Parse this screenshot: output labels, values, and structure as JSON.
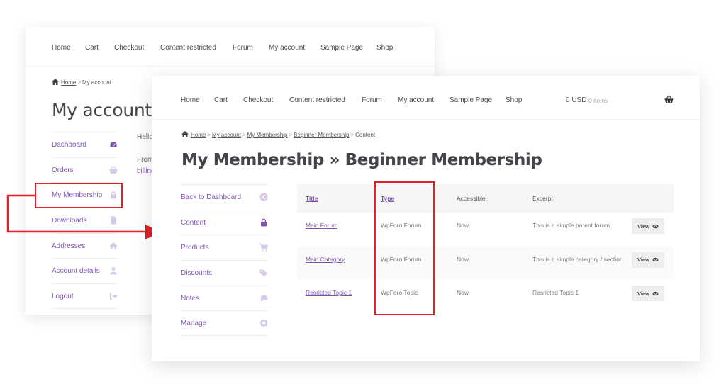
{
  "nav_items": [
    "Home",
    "Cart",
    "Checkout",
    "Content restricted",
    "Forum",
    "My account",
    "Sample Page",
    "Shop"
  ],
  "back_panel": {
    "breadcrumb": {
      "home": "Home",
      "current": "My account",
      "separator": ">"
    },
    "title": "My account",
    "menu": [
      {
        "label": "Dashboard",
        "icon": "dashboard-icon",
        "active": true
      },
      {
        "label": "Orders",
        "icon": "basket-icon",
        "active": false
      },
      {
        "label": "My Membership",
        "icon": "lock-icon",
        "active": false,
        "highlighted": true
      },
      {
        "label": "Downloads",
        "icon": "file-icon",
        "active": false
      },
      {
        "label": "Addresses",
        "icon": "home-icon",
        "active": false
      },
      {
        "label": "Account details",
        "icon": "user-icon",
        "active": false
      },
      {
        "label": "Logout",
        "icon": "sign-out-icon",
        "active": false
      }
    ],
    "hello_text": "Hello",
    "from_text": "From",
    "billing_link": "billing"
  },
  "front_panel": {
    "cart": {
      "total": "0 USD",
      "count": "0 items"
    },
    "breadcrumb": {
      "links": [
        "Home",
        "My account",
        "My Membership",
        "Beginner Membership"
      ],
      "current": "Content",
      "separator": ">"
    },
    "title": "My Membership » Beginner Membership",
    "menu": [
      {
        "label": "Back to Dashboard",
        "icon": "arrow-circle-left-icon",
        "active": false
      },
      {
        "label": "Content",
        "icon": "lock-icon",
        "active": true
      },
      {
        "label": "Products",
        "icon": "cart-icon",
        "active": false
      },
      {
        "label": "Discounts",
        "icon": "tags-icon",
        "active": false
      },
      {
        "label": "Notes",
        "icon": "comment-icon",
        "active": false
      },
      {
        "label": "Manage",
        "icon": "gear-icon",
        "active": false
      }
    ],
    "table": {
      "headers": [
        "Title",
        "Type",
        "Accessible",
        "Excerpt",
        ""
      ],
      "rows": [
        {
          "title": "Main Forum",
          "type": "WpForo Forum",
          "accessible": "Now",
          "excerpt": "This is a simple parent forum",
          "action": "View"
        },
        {
          "title": "Main Category",
          "type": "WpForo Forum",
          "accessible": "Now",
          "excerpt": "This is a simple category / section",
          "action": "View"
        },
        {
          "title": "Resricted Topic 1",
          "type": "WpForo Topic",
          "accessible": "Now",
          "excerpt": "Resricted Topic 1",
          "action": "View"
        }
      ]
    }
  },
  "colors": {
    "accent": "#7f54b3",
    "accent_light": "#d6c9ea",
    "annotation_red": "#e41e26",
    "text": "#43454b"
  }
}
